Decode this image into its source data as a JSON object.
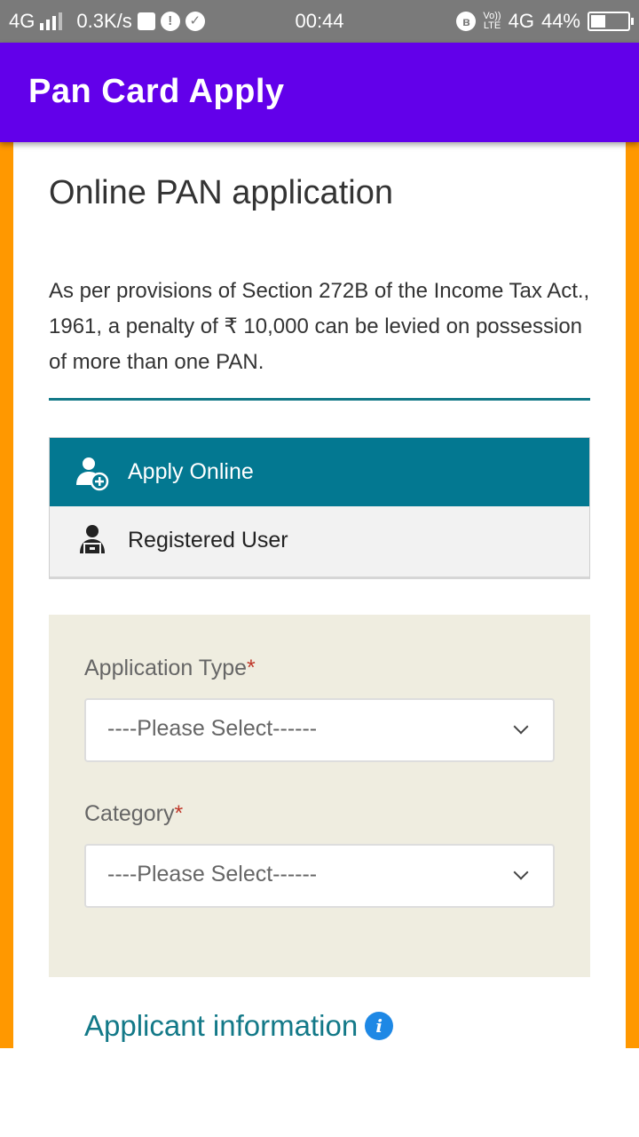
{
  "status_bar": {
    "network": "4G",
    "speed": "0.3K/s",
    "time": "00:44",
    "lte_top": "Vo))",
    "lte_bottom": "LTE",
    "network_right": "4G",
    "battery": "44%",
    "battery_level": 0.44
  },
  "app_bar": {
    "title": "Pan Card Apply",
    "color": "#6200ea"
  },
  "page": {
    "heading": "Online PAN application",
    "notice": "As per provisions of Section 272B of the Income Tax Act., 1961, a penalty of ₹ 10,000 can be levied on possession of more than one PAN.",
    "accent_color": "#137988",
    "frame_color": "#ff9800"
  },
  "tabs": [
    {
      "label": "Apply Online",
      "icon": "user-add-icon",
      "active": true
    },
    {
      "label": "Registered User",
      "icon": "registered-user-icon",
      "active": false
    }
  ],
  "form": {
    "application_type": {
      "label": "Application Type",
      "required_mark": "*",
      "value": "----Please Select------"
    },
    "category": {
      "label": "Category",
      "required_mark": "*",
      "value": "----Please Select------"
    }
  },
  "section": {
    "title": "Applicant information",
    "icon": "info-icon"
  }
}
